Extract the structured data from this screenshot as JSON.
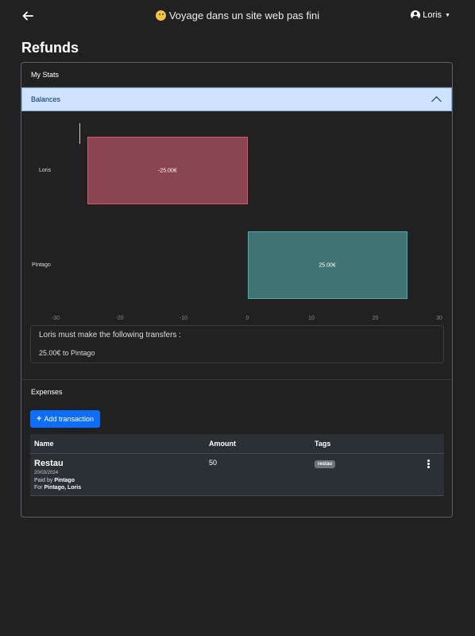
{
  "header": {
    "title": "Voyage dans un site web pas fini",
    "user_label": "Loris",
    "back_icon": "arrow-left-icon",
    "user_icon": "user-circle-icon"
  },
  "page": {
    "title": "Refunds"
  },
  "stats": {
    "title": "My Stats",
    "balances_label": "Balances"
  },
  "chart_data": {
    "type": "bar",
    "orientation": "horizontal",
    "categories": [
      "Loris",
      "Pintago"
    ],
    "values": [
      -25,
      25
    ],
    "data_labels": [
      "-25.00€",
      "25.00€"
    ],
    "colors": [
      "#8b4452",
      "#3f7472"
    ],
    "xlim": [
      -30,
      30
    ],
    "xticks": [
      "-30",
      "-20",
      "-10",
      "0",
      "10",
      "20",
      "30"
    ]
  },
  "transfers": {
    "heading": "Loris must make the following transfers :",
    "items": [
      "25.00€ to Pintago"
    ]
  },
  "expenses": {
    "title": "Expenses",
    "add_label": "Add transaction",
    "columns": [
      "Name",
      "Amount",
      "Tags"
    ],
    "rows": [
      {
        "name": "Restau",
        "date": "20/03/2024",
        "paid_by_label": "Paid by",
        "paid_by": "Pintago",
        "for_label": "For",
        "for": "Pintago, Loris",
        "amount": "50",
        "tag": "restau"
      }
    ]
  }
}
